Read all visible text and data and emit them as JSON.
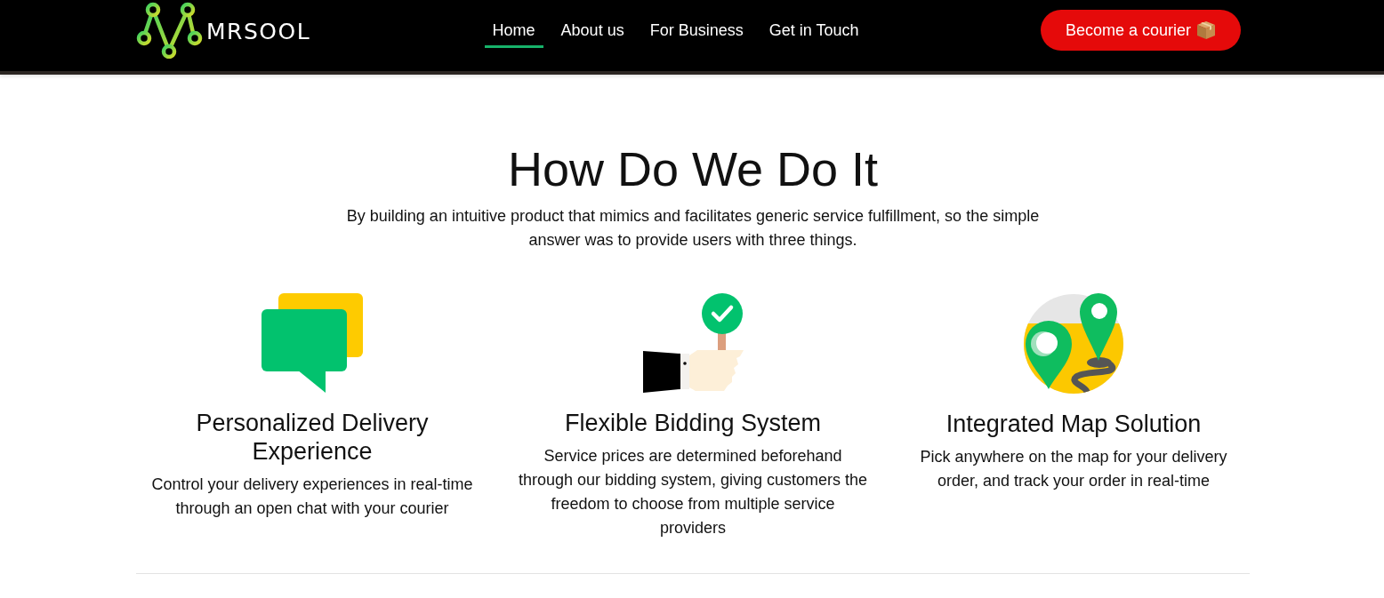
{
  "header": {
    "logo": {
      "text": "MRSOOL"
    },
    "nav": [
      {
        "label": "Home",
        "selected": true
      },
      {
        "label": "About us",
        "selected": false
      },
      {
        "label": "For Business",
        "selected": false
      },
      {
        "label": "Get in Touch",
        "selected": false
      }
    ],
    "cta_button": {
      "label": "Become a courier"
    }
  },
  "section": {
    "title": "How Do We Do It",
    "subtitle": "By building an intuitive product that mimics and facilitates generic service fulfillment, so the simple answer was to provide users with three things.",
    "features": [
      {
        "kind": "chat",
        "title": "Personalized Delivery Experience",
        "description": "Control your delivery experiences in real-time through an open chat with your courier"
      },
      {
        "kind": "bidding",
        "title": "Flexible Bidding System",
        "description": "Service prices are determined beforehand through our bidding system, giving customers the freedom to choose from multiple service providers"
      },
      {
        "kind": "map",
        "title": "Integrated Map Solution",
        "description": "Pick anywhere on the map for your delivery order, and track your order in real-time"
      }
    ]
  }
}
